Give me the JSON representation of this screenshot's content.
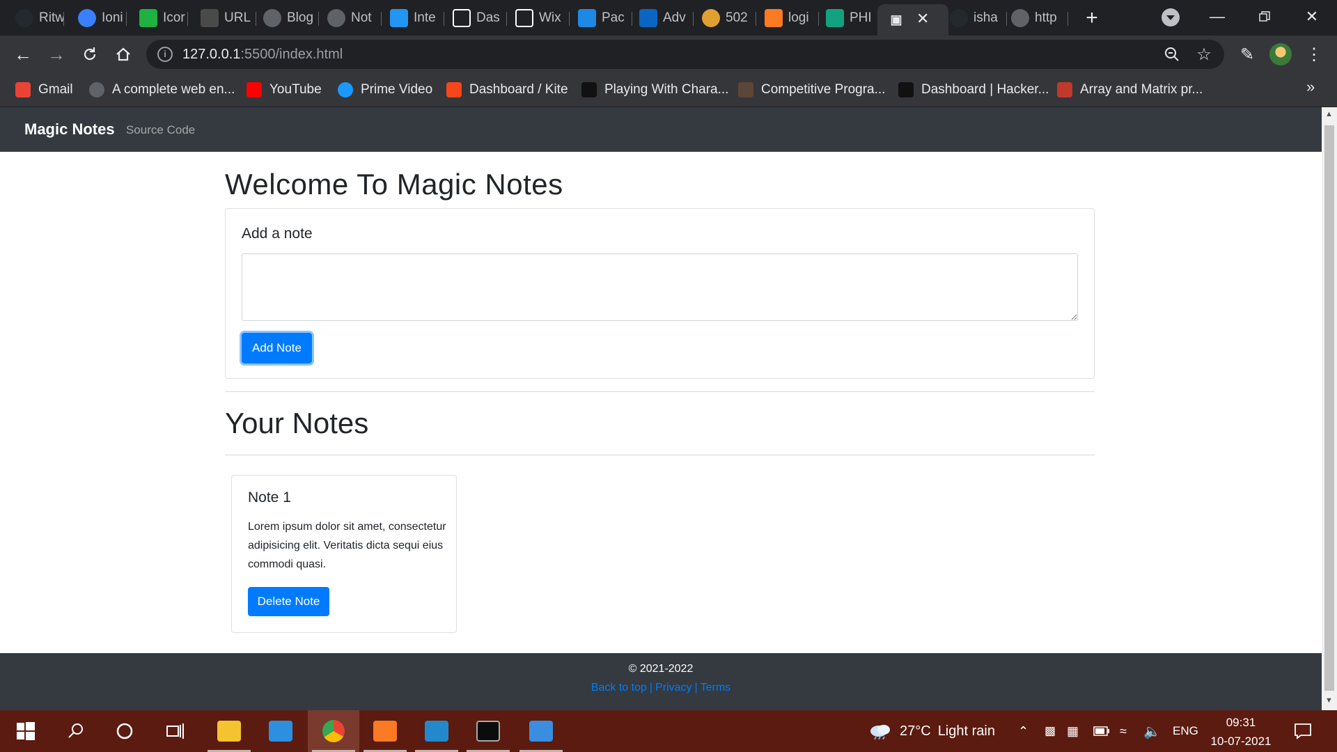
{
  "tabs": [
    {
      "label": "Ritw",
      "icon": "github-icon",
      "color": "#24292e"
    },
    {
      "label": "Ioni",
      "icon": "ionic-icon",
      "color": "#3880ff"
    },
    {
      "label": "Icor",
      "icon": "icons8-icon",
      "color": "#1fb141"
    },
    {
      "label": "URL",
      "icon": "url-shortener-icon",
      "color": "#4a4a4a"
    },
    {
      "label": "Blog",
      "icon": "globe-icon",
      "color": "#5f6368"
    },
    {
      "label": "Not",
      "icon": "globe-icon",
      "color": "#5f6368"
    },
    {
      "label": "Inte",
      "icon": "is-icon",
      "color": "#2196f3"
    },
    {
      "label": "Das",
      "icon": "wix-icon",
      "color": "#ffffff"
    },
    {
      "label": "Wix",
      "icon": "wix-icon",
      "color": "#ffffff"
    },
    {
      "label": "Pac",
      "icon": "package-icon",
      "color": "#1e88e5"
    },
    {
      "label": "Adv",
      "icon": "linkedin-icon",
      "color": "#0a66c2"
    },
    {
      "label": "502",
      "icon": "chrome-error-icon",
      "color": "#e0a030"
    },
    {
      "label": "logi",
      "icon": "xampp-icon",
      "color": "#fb7a24"
    },
    {
      "label": "PHI",
      "icon": "phi-icon",
      "color": "#11a37f"
    },
    {
      "label": "",
      "icon": "new-file-icon",
      "color": "#e8eaed"
    },
    {
      "label": "isha",
      "icon": "github-icon",
      "color": "#24292e"
    },
    {
      "label": "http",
      "icon": "globe-icon",
      "color": "#5f6368"
    }
  ],
  "address_bar": {
    "host": "127.0.0.1",
    "path": ":5500/index.html"
  },
  "bookmarks": [
    {
      "label": "Gmail",
      "icon": "gmail-icon",
      "color": "#ea4335"
    },
    {
      "label": "A complete web en...",
      "icon": "globe-icon",
      "color": "#5f6368"
    },
    {
      "label": "YouTube",
      "icon": "youtube-icon",
      "color": "#ff0000"
    },
    {
      "label": "Prime Video",
      "icon": "prime-video-icon",
      "color": "#1a98ff"
    },
    {
      "label": "Dashboard / Kite",
      "icon": "kite-icon",
      "color": "#f6461a"
    },
    {
      "label": "Playing With Chara...",
      "icon": "hackerrank-icon",
      "color": "#111111"
    },
    {
      "label": "Competitive Progra...",
      "icon": "codechef-icon",
      "color": "#5b4638"
    },
    {
      "label": "Dashboard | Hacker...",
      "icon": "hackerrank-icon",
      "color": "#111111"
    },
    {
      "label": "Array and Matrix pr...",
      "icon": "bookmark-red-icon",
      "color": "#c0392b"
    }
  ],
  "site": {
    "brand": "Magic Notes",
    "nav_link": "Source Code",
    "welcome": "Welcome To Magic Notes",
    "add_label": "Add a note",
    "textarea_value": "",
    "add_button": "Add Note",
    "notes_heading": "Your Notes",
    "notes": [
      {
        "title": "Note 1",
        "text": "Lorem ipsum dolor sit amet, consectetur adipisicing elit. Veritatis dicta sequi eius commodi quasi.",
        "delete_label": "Delete Note"
      }
    ],
    "footer": {
      "copyright": "© 2021-2022",
      "links": [
        "Back to top",
        "Privacy",
        "Terms"
      ]
    },
    "accent_color": "#007bff",
    "nav_color": "#343a40"
  },
  "taskbar": {
    "apps": [
      {
        "name": "file-explorer",
        "color": "#f4c430"
      },
      {
        "name": "mail",
        "color": "#2d8fe0"
      },
      {
        "name": "chrome",
        "color": "#34a853"
      },
      {
        "name": "xampp",
        "color": "#fb7a24"
      },
      {
        "name": "vscode",
        "color": "#2489ca"
      },
      {
        "name": "terminal",
        "color": "#0c0c0c"
      },
      {
        "name": "photos",
        "color": "#3b8de0"
      }
    ],
    "weather": "27°C",
    "weather_desc": "Light rain",
    "lang": "ENG",
    "time": "09:31",
    "date": "10-07-2021"
  }
}
